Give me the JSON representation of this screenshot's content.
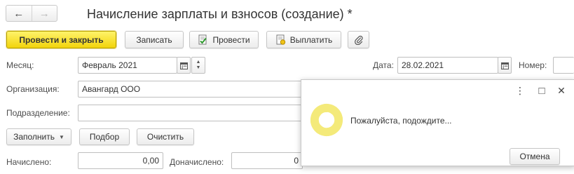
{
  "window": {
    "title": "Начисление зарплаты и взносов (создание) *"
  },
  "nav": {
    "back_glyph": "←",
    "forward_glyph": "→"
  },
  "toolbar": {
    "post_and_close": "Провести и закрыть",
    "save": "Записать",
    "post": "Провести",
    "pay": "Выплатить",
    "attach_icon": "paperclip-icon"
  },
  "form": {
    "month_label": "Месяц:",
    "month_value": "Февраль 2021",
    "date_label": "Дата:",
    "date_value": "28.02.2021",
    "number_label": "Номер:",
    "number_value": "",
    "organization_label": "Организация:",
    "organization_value": "Авангард ООО",
    "department_label": "Подразделение:",
    "department_value": "",
    "fill_button": "Заполнить",
    "select_button": "Подбор",
    "clear_button": "Очистить",
    "accrued_label": "Начислено:",
    "accrued_value": "0,00",
    "additional_label": "Доначислено:",
    "additional_value": "0"
  },
  "dialog": {
    "message": "Пожалуйста, подождите...",
    "cancel_button": "Отмена",
    "menu_glyph": "⋮",
    "maximize_glyph": "□",
    "close_glyph": "✕"
  },
  "colors": {
    "primary_button": "#f2d40c",
    "spinner": "#f2e66a"
  }
}
